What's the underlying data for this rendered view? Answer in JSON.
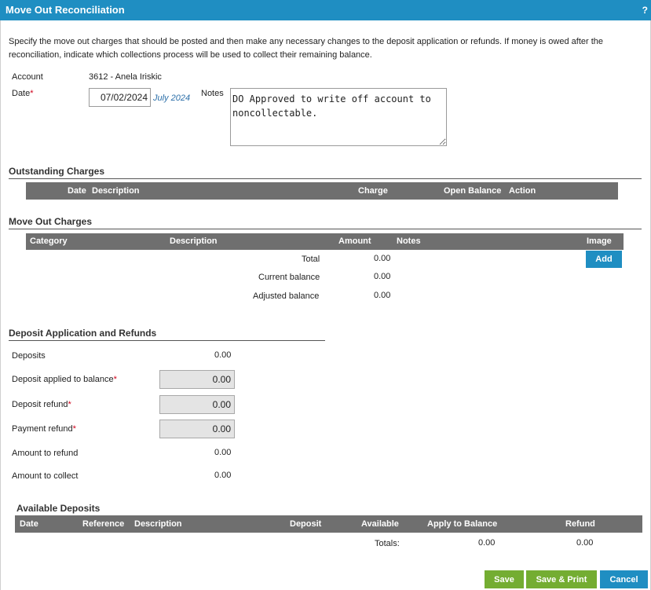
{
  "window": {
    "title": "Move Out Reconciliation",
    "help_label": "?"
  },
  "intro": "Specify the move out charges that should be posted and then make any necessary changes to the deposit application or refunds. If money is owed after the reconciliation, indicate which collections process will be used to collect their remaining balance.",
  "account": {
    "label": "Account",
    "value": "3612 - Anela Iriskic"
  },
  "date": {
    "label": "Date",
    "required": "*",
    "value": "07/02/2024",
    "hint": "July 2024"
  },
  "notes": {
    "label": "Notes",
    "value": "DO Approved to write off account to noncollectable."
  },
  "outstanding": {
    "title": "Outstanding Charges",
    "columns": {
      "date": "Date",
      "description": "Description",
      "charge": "Charge",
      "open_balance": "Open Balance",
      "action": "Action"
    }
  },
  "move_out": {
    "title": "Move Out Charges",
    "columns": {
      "category": "Category",
      "description": "Description",
      "amount": "Amount",
      "notes": "Notes",
      "image": "Image"
    },
    "total_label": "Total",
    "total_value": "0.00",
    "current_label": "Current balance",
    "current_value": "0.00",
    "adjusted_label": "Adjusted balance",
    "adjusted_value": "0.00",
    "add_label": "Add"
  },
  "deposit": {
    "title": "Deposit Application and Refunds",
    "deposits_label": "Deposits",
    "deposits_value": "0.00",
    "applied_label": "Deposit applied to balance",
    "applied_value": "0.00",
    "refund_label": "Deposit refund",
    "refund_value": "0.00",
    "payment_label": "Payment refund",
    "payment_value": "0.00",
    "amount_refund_label": "Amount to refund",
    "amount_refund_value": "0.00",
    "amount_collect_label": "Amount to collect",
    "amount_collect_value": "0.00",
    "required": "*"
  },
  "available": {
    "title": "Available Deposits",
    "columns": {
      "date": "Date",
      "reference": "Reference",
      "description": "Description",
      "deposit": "Deposit",
      "available": "Available",
      "apply": "Apply to Balance",
      "refund": "Refund"
    },
    "totals_label": "Totals:",
    "totals_apply": "0.00",
    "totals_refund": "0.00"
  },
  "buttons": {
    "save": "Save",
    "save_print": "Save & Print",
    "cancel": "Cancel"
  },
  "colors": {
    "titlebar": "#1f8ec2",
    "header": "#6f6f6f",
    "save": "#74ad32",
    "cancel": "#1f8ec2",
    "required": "#d0021b"
  }
}
